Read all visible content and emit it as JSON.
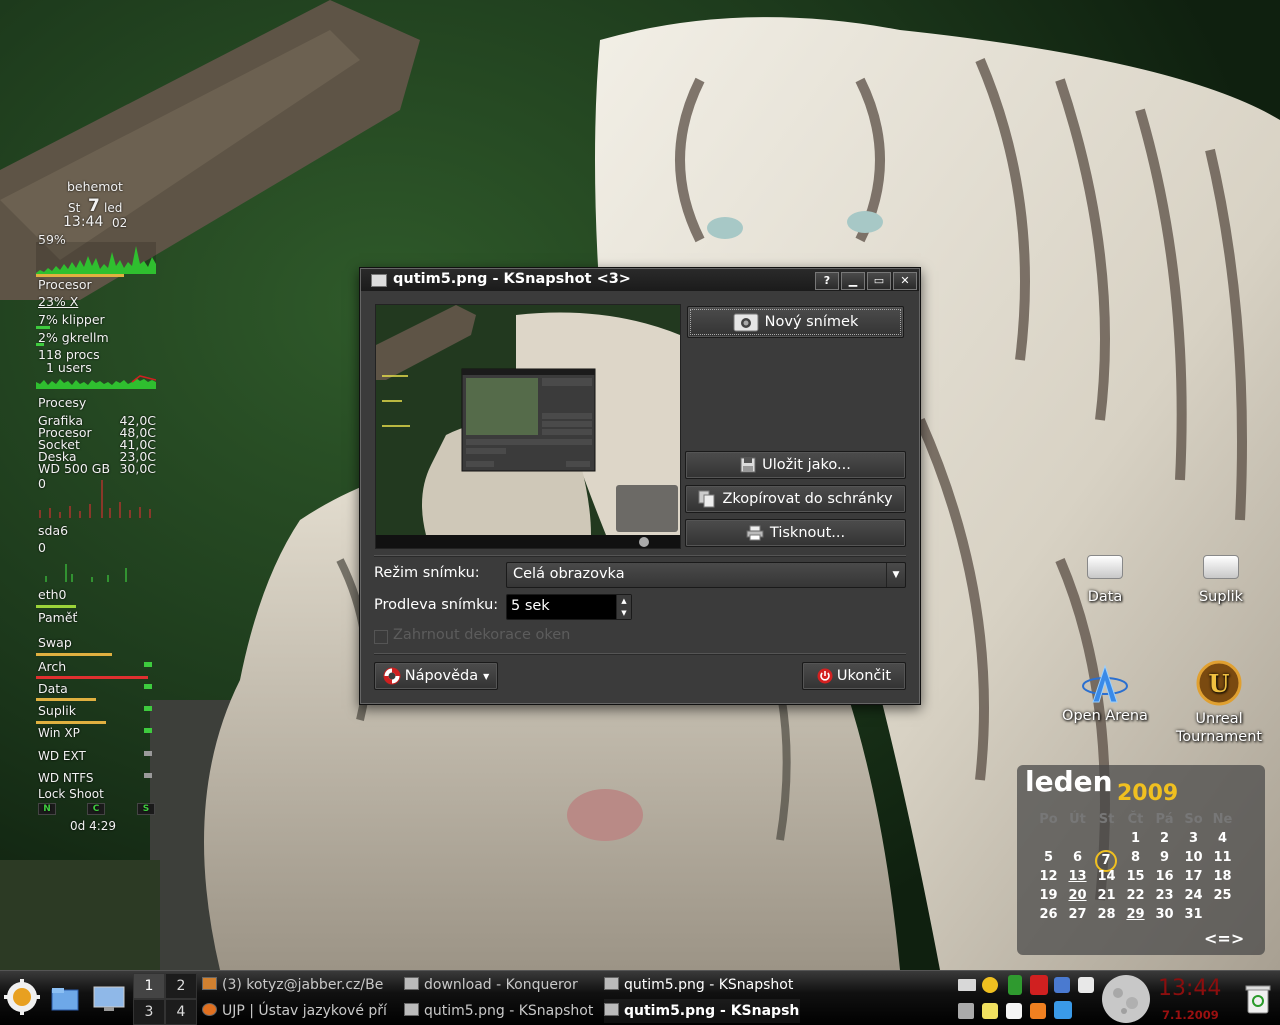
{
  "gkrellm": {
    "hostname": "behemot",
    "day": "St",
    "daynum": "7",
    "month": "led",
    "time": "13:44",
    "seconds": "02",
    "cpu_percent": "59%",
    "procesor_label": "Procesor",
    "proc_x": "23% X",
    "proc_klipper": "7% klipper",
    "proc_gkrellm": "2% gkrellm",
    "procs": "118 procs",
    "users": "1 users",
    "procesy_label": "Procesy",
    "sensors": [
      {
        "name": "Grafika",
        "value": "42,0C"
      },
      {
        "name": "Procesor",
        "value": "48,0C"
      },
      {
        "name": "Socket",
        "value": "41,0C"
      },
      {
        "name": "Deska",
        "value": "23,0C"
      },
      {
        "name": "WD 500 GB",
        "value": "30,0C"
      }
    ],
    "disk_value": "0",
    "sda6_label": "sda6",
    "sda6_value": "0",
    "eth0_label": "eth0",
    "pamet_label": "Paměť",
    "swap_label": "Swap",
    "mounts": [
      "Arch",
      "Data",
      "Suplik",
      "Win XP",
      "WD EXT",
      "WD NTFS"
    ],
    "lock_shoot": "Lock  Shoot",
    "ind_n": "N",
    "ind_c": "C",
    "ind_s": "S",
    "uptime": "0d  4:29"
  },
  "dialog": {
    "title": "qutim5.png - KSnapshot <3>",
    "help_btn": "?",
    "new_snapshot": "Nový snímek",
    "save_as": "Uložit jako...",
    "copy_clipboard": "Zkopírovat do schránky",
    "print": "Tisknout...",
    "mode_label": "Režim snímku:",
    "mode_value": "Celá obrazovka",
    "delay_label": "Prodleva snímku:",
    "delay_value": "5 sek",
    "include_decorations": "Zahrnout dekorace oken",
    "help": "Nápověda",
    "quit": "Ukončit"
  },
  "desktop_icons": [
    {
      "label": "Data"
    },
    {
      "label": "Suplik"
    },
    {
      "label": "Open Arena"
    },
    {
      "label": "Unreal Tournament"
    }
  ],
  "calendar": {
    "month": "leden",
    "year": "2009",
    "weekdays": [
      "Po",
      "Út",
      "St",
      "Čt",
      "Pá",
      "So",
      "Ne"
    ],
    "weeks": [
      [
        "",
        "",
        "",
        "1",
        "2",
        "3",
        "4"
      ],
      [
        "5",
        "6",
        "7",
        "8",
        "9",
        "10",
        "11"
      ],
      [
        "12",
        "13",
        "14",
        "15",
        "16",
        "17",
        "18"
      ],
      [
        "19",
        "20",
        "21",
        "22",
        "23",
        "24",
        "25"
      ],
      [
        "26",
        "27",
        "28",
        "29",
        "30",
        "31",
        ""
      ]
    ],
    "today": "7",
    "underlined": [
      "13",
      "20",
      "29"
    ],
    "nav": "<=>"
  },
  "taskbar": {
    "pager": [
      "1",
      "2",
      "3",
      "4"
    ],
    "tasks_top": [
      "(3) kotyz@jabber.cz/Be",
      "download - Konqueror",
      "qutim5.png - KSnapshot"
    ],
    "tasks_bottom": [
      "UJP | Ústav jazykové pří",
      "qutim5.png - KSnapshot",
      "qutim5.png - KSnapshot"
    ],
    "clock": "13:44",
    "date": "7.1.2009",
    "colors": {
      "clock": "#8b0e0e"
    }
  }
}
